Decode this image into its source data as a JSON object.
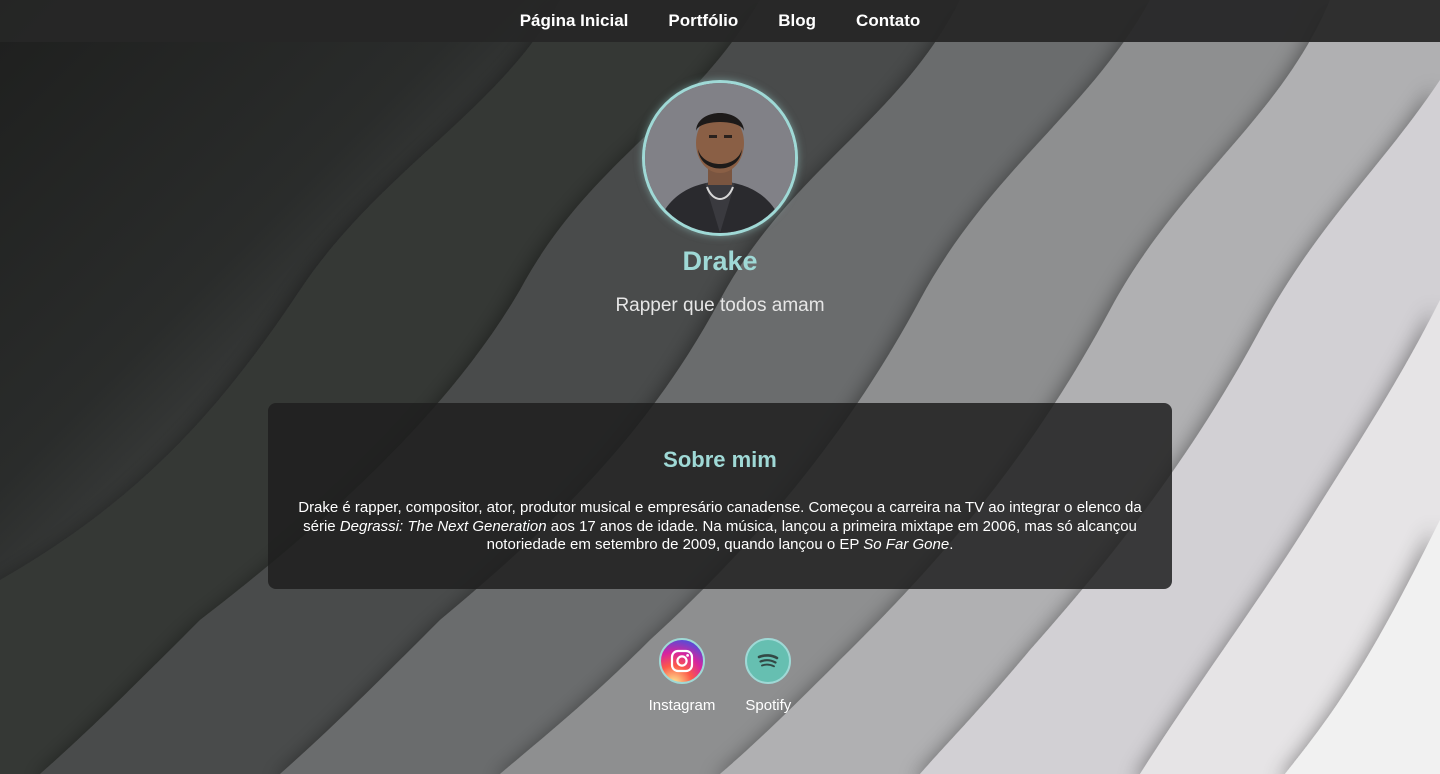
{
  "nav": {
    "items": [
      "Página Inicial",
      "Portfólio",
      "Blog",
      "Contato"
    ]
  },
  "profile": {
    "name": "Drake",
    "tagline": "Rapper que todos amam",
    "avatar_alt": "Drake"
  },
  "about": {
    "title": "Sobre mim",
    "text_1": "Drake é rapper, compositor, ator, produtor musical e empresário canadense. Começou a carreira na TV ao integrar o elenco da série ",
    "italic_1": "Degrassi: The Next Generation",
    "text_2": " aos 17 anos de idade. Na música, lançou a primeira mixtape em 2006, mas só alcançou notoriedade em setembro de 2009, quando lançou o EP ",
    "italic_2": "So Far Gone",
    "text_3": "."
  },
  "social": {
    "items": [
      {
        "label": "Instagram",
        "icon": "instagram-icon"
      },
      {
        "label": "Spotify",
        "icon": "spotify-icon"
      }
    ]
  },
  "colors": {
    "accent": "#9fd9d6",
    "nav_bg": "#262626",
    "card_bg": "#1e1e1e",
    "spotify": "#66bfb1"
  }
}
